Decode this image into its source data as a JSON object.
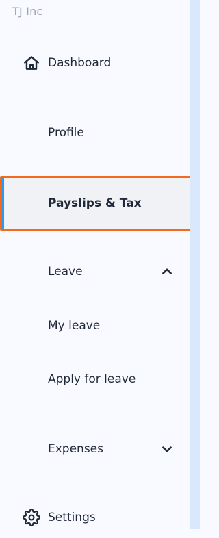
{
  "company": {
    "name": "TJ Inc"
  },
  "nav": {
    "dashboard": {
      "label": "Dashboard",
      "icon": "home-icon"
    },
    "profile": {
      "label": "Profile"
    },
    "payslips": {
      "label": "Payslips & Tax"
    },
    "leave": {
      "label": "Leave",
      "chevron": "chevron-up-icon"
    },
    "my_leave": {
      "label": "My leave"
    },
    "apply_leave": {
      "label": "Apply for leave"
    },
    "expenses": {
      "label": "Expenses",
      "chevron": "chevron-down-icon"
    },
    "settings": {
      "label": "Settings",
      "icon": "gear-icon"
    }
  },
  "colors": {
    "active_border": "#f26b1d",
    "active_accent": "#2b97f4",
    "background": "#f8faff",
    "scroll_strip": "#d9e9fb"
  }
}
